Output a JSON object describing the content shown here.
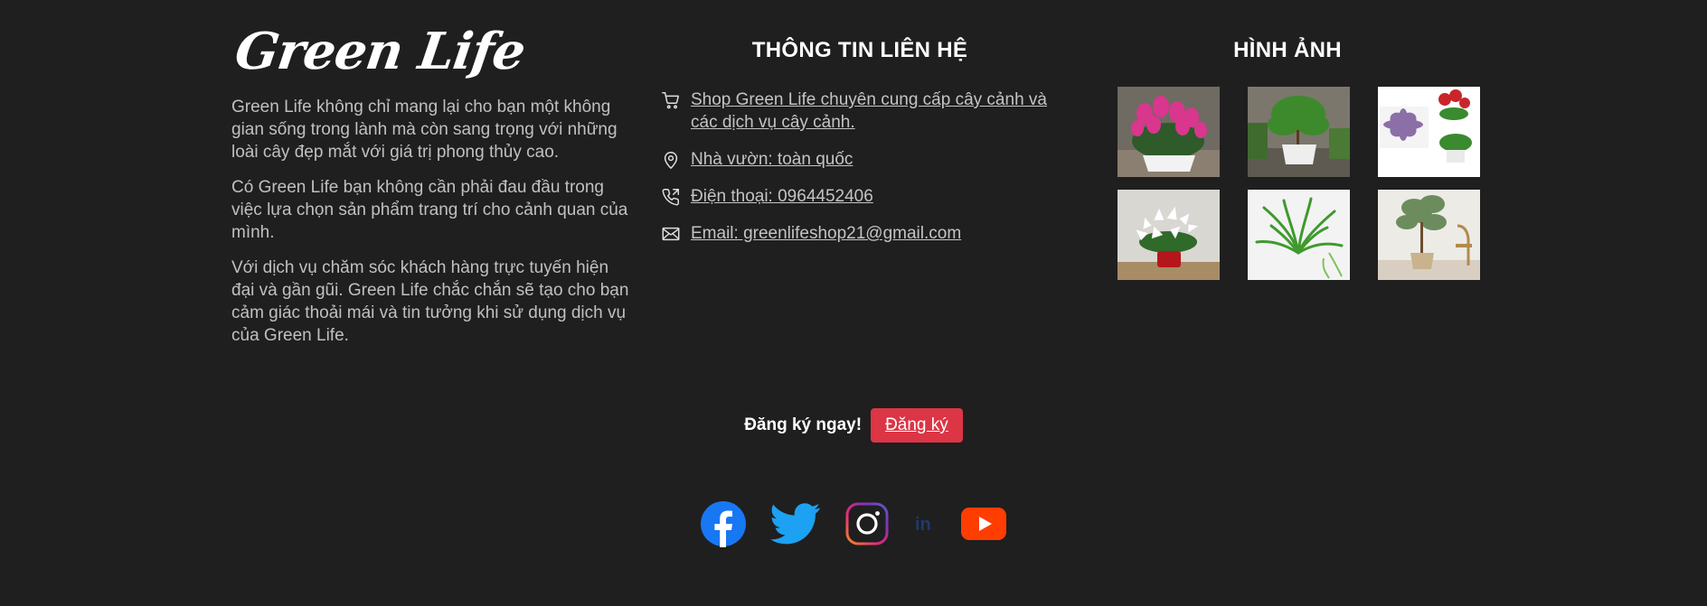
{
  "brand": {
    "logo_text": "Green Life",
    "paragraphs": [
      "Green Life không chỉ mang lại cho bạn một không gian sống trong lành mà còn sang trọng với những loài cây đẹp mắt với giá trị phong thủy cao.",
      "Có Green Life bạn không cần phải đau đầu trong việc lựa chọn sản phẩm trang trí cho cảnh quan của mình.",
      "Với dịch vụ chăm sóc khách hàng trực tuyến hiện đại và gần gũi. Green Life chắc chắn sẽ tạo cho bạn cảm giác thoải mái và tin tưởng khi sử dụng dịch vụ của Green Life."
    ]
  },
  "contact": {
    "title": "THÔNG TIN LIÊN HỆ",
    "items": [
      {
        "icon": "cart-icon",
        "text": "Shop Green Life chuyên cung cấp cây cảnh và các dịch vụ cây cảnh."
      },
      {
        "icon": "location-pin-icon",
        "text": "Nhà vườn: toàn quốc"
      },
      {
        "icon": "phone-icon",
        "text": "Điện thoại: 0964452406"
      },
      {
        "icon": "envelope-icon",
        "text": "Email: greenlifeshop21@gmail.com"
      }
    ]
  },
  "gallery": {
    "title": "HÌNH ẢNH",
    "images": [
      "cyclamen-plant",
      "potted-tree-plant",
      "succulent-collage",
      "white-flower-pot",
      "spider-plant",
      "olive-tree-pot"
    ]
  },
  "subscribe": {
    "label": "Đăng ký ngay!",
    "button": "Đăng ký",
    "button_color": "#dc3545"
  },
  "social": [
    "facebook-icon",
    "twitter-icon",
    "instagram-icon",
    "linkedin-icon",
    "youtube-icon"
  ],
  "colors": {
    "background": "#1f1f1f",
    "text": "#c4c4c4",
    "heading": "#ffffff"
  }
}
